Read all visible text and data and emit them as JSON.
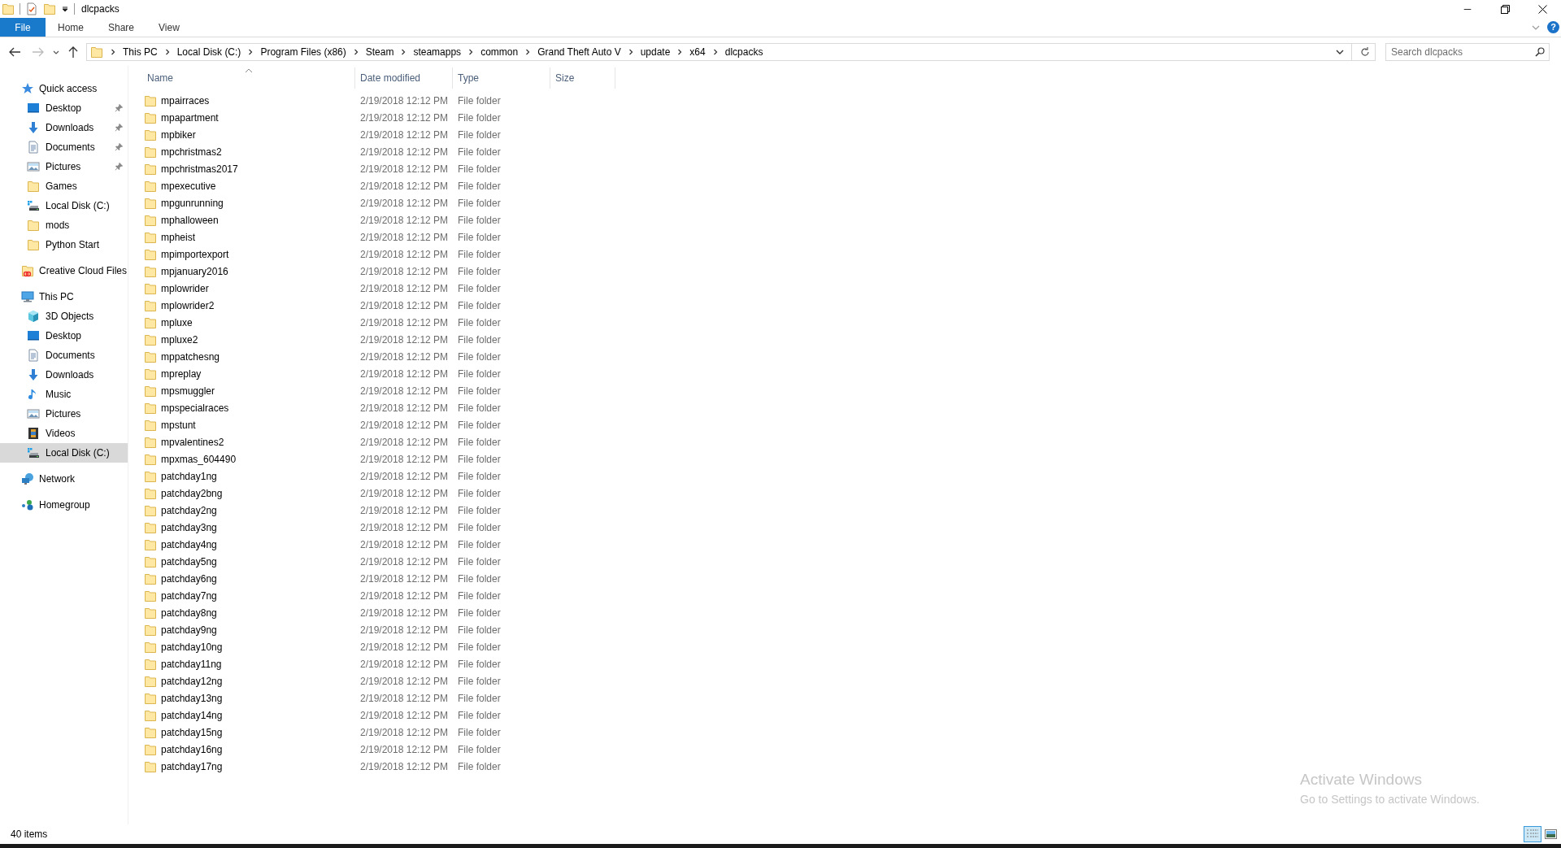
{
  "window": {
    "title": "dlcpacks",
    "minimize": "─",
    "help": "?"
  },
  "ribbon_tabs": [
    {
      "label": "File",
      "selected": true
    },
    {
      "label": "Home",
      "selected": false
    },
    {
      "label": "Share",
      "selected": false
    },
    {
      "label": "View",
      "selected": false
    }
  ],
  "breadcrumbs": [
    "This PC",
    "Local Disk (C:)",
    "Program Files (x86)",
    "Steam",
    "steamapps",
    "common",
    "Grand Theft Auto V",
    "update",
    "x64",
    "dlcpacks"
  ],
  "search": {
    "placeholder": "Search dlcpacks"
  },
  "sidebar": [
    {
      "label": "Quick access",
      "kind": "star",
      "children": [
        {
          "label": "Desktop",
          "kind": "desktop",
          "pinned": true,
          "selected": false
        },
        {
          "label": "Downloads",
          "kind": "download",
          "pinned": true,
          "selected": false
        },
        {
          "label": "Documents",
          "kind": "document",
          "pinned": true,
          "selected": false
        },
        {
          "label": "Pictures",
          "kind": "picture",
          "pinned": true,
          "selected": false
        },
        {
          "label": "Games",
          "kind": "folder",
          "pinned": false,
          "selected": false
        },
        {
          "label": "Local Disk (C:)",
          "kind": "drive",
          "pinned": false,
          "selected": false
        },
        {
          "label": "mods",
          "kind": "folder",
          "pinned": false,
          "selected": false
        },
        {
          "label": "Python Start",
          "kind": "folder",
          "pinned": false,
          "selected": false
        }
      ]
    },
    {
      "label": "Creative Cloud Files",
      "kind": "cloud"
    },
    {
      "label": "This PC",
      "kind": "pc",
      "children": [
        {
          "label": "3D Objects",
          "kind": "cube",
          "pinned": false,
          "selected": false
        },
        {
          "label": "Desktop",
          "kind": "desktop",
          "pinned": false,
          "selected": false
        },
        {
          "label": "Documents",
          "kind": "document",
          "pinned": false,
          "selected": false
        },
        {
          "label": "Downloads",
          "kind": "download",
          "pinned": false,
          "selected": false
        },
        {
          "label": "Music",
          "kind": "music",
          "pinned": false,
          "selected": false
        },
        {
          "label": "Pictures",
          "kind": "picture",
          "pinned": false,
          "selected": false
        },
        {
          "label": "Videos",
          "kind": "video",
          "pinned": false,
          "selected": false
        },
        {
          "label": "Local Disk (C:)",
          "kind": "drive",
          "pinned": false,
          "selected": true
        }
      ]
    },
    {
      "label": "Network",
      "kind": "network"
    },
    {
      "label": "Homegroup",
      "kind": "homegroup"
    }
  ],
  "table": {
    "columns": [
      {
        "label": "Name",
        "sorted": true
      },
      {
        "label": "Date modified",
        "sorted": false
      },
      {
        "label": "Type",
        "sorted": false
      },
      {
        "label": "Size",
        "sorted": false
      }
    ],
    "rows": [
      {
        "name": "mpairraces",
        "date": "2/19/2018 12:12 PM",
        "type": "File folder"
      },
      {
        "name": "mpapartment",
        "date": "2/19/2018 12:12 PM",
        "type": "File folder"
      },
      {
        "name": "mpbiker",
        "date": "2/19/2018 12:12 PM",
        "type": "File folder"
      },
      {
        "name": "mpchristmas2",
        "date": "2/19/2018 12:12 PM",
        "type": "File folder"
      },
      {
        "name": "mpchristmas2017",
        "date": "2/19/2018 12:12 PM",
        "type": "File folder"
      },
      {
        "name": "mpexecutive",
        "date": "2/19/2018 12:12 PM",
        "type": "File folder"
      },
      {
        "name": "mpgunrunning",
        "date": "2/19/2018 12:12 PM",
        "type": "File folder"
      },
      {
        "name": "mphalloween",
        "date": "2/19/2018 12:12 PM",
        "type": "File folder"
      },
      {
        "name": "mpheist",
        "date": "2/19/2018 12:12 PM",
        "type": "File folder"
      },
      {
        "name": "mpimportexport",
        "date": "2/19/2018 12:12 PM",
        "type": "File folder"
      },
      {
        "name": "mpjanuary2016",
        "date": "2/19/2018 12:12 PM",
        "type": "File folder"
      },
      {
        "name": "mplowrider",
        "date": "2/19/2018 12:12 PM",
        "type": "File folder"
      },
      {
        "name": "mplowrider2",
        "date": "2/19/2018 12:12 PM",
        "type": "File folder"
      },
      {
        "name": "mpluxe",
        "date": "2/19/2018 12:12 PM",
        "type": "File folder"
      },
      {
        "name": "mpluxe2",
        "date": "2/19/2018 12:12 PM",
        "type": "File folder"
      },
      {
        "name": "mppatchesng",
        "date": "2/19/2018 12:12 PM",
        "type": "File folder"
      },
      {
        "name": "mpreplay",
        "date": "2/19/2018 12:12 PM",
        "type": "File folder"
      },
      {
        "name": "mpsmuggler",
        "date": "2/19/2018 12:12 PM",
        "type": "File folder"
      },
      {
        "name": "mpspecialraces",
        "date": "2/19/2018 12:12 PM",
        "type": "File folder"
      },
      {
        "name": "mpstunt",
        "date": "2/19/2018 12:12 PM",
        "type": "File folder"
      },
      {
        "name": "mpvalentines2",
        "date": "2/19/2018 12:12 PM",
        "type": "File folder"
      },
      {
        "name": "mpxmas_604490",
        "date": "2/19/2018 12:12 PM",
        "type": "File folder"
      },
      {
        "name": "patchday1ng",
        "date": "2/19/2018 12:12 PM",
        "type": "File folder"
      },
      {
        "name": "patchday2bng",
        "date": "2/19/2018 12:12 PM",
        "type": "File folder"
      },
      {
        "name": "patchday2ng",
        "date": "2/19/2018 12:12 PM",
        "type": "File folder"
      },
      {
        "name": "patchday3ng",
        "date": "2/19/2018 12:12 PM",
        "type": "File folder"
      },
      {
        "name": "patchday4ng",
        "date": "2/19/2018 12:12 PM",
        "type": "File folder"
      },
      {
        "name": "patchday5ng",
        "date": "2/19/2018 12:12 PM",
        "type": "File folder"
      },
      {
        "name": "patchday6ng",
        "date": "2/19/2018 12:12 PM",
        "type": "File folder"
      },
      {
        "name": "patchday7ng",
        "date": "2/19/2018 12:12 PM",
        "type": "File folder"
      },
      {
        "name": "patchday8ng",
        "date": "2/19/2018 12:12 PM",
        "type": "File folder"
      },
      {
        "name": "patchday9ng",
        "date": "2/19/2018 12:12 PM",
        "type": "File folder"
      },
      {
        "name": "patchday10ng",
        "date": "2/19/2018 12:12 PM",
        "type": "File folder"
      },
      {
        "name": "patchday11ng",
        "date": "2/19/2018 12:12 PM",
        "type": "File folder"
      },
      {
        "name": "patchday12ng",
        "date": "2/19/2018 12:12 PM",
        "type": "File folder"
      },
      {
        "name": "patchday13ng",
        "date": "2/19/2018 12:12 PM",
        "type": "File folder"
      },
      {
        "name": "patchday14ng",
        "date": "2/19/2018 12:12 PM",
        "type": "File folder"
      },
      {
        "name": "patchday15ng",
        "date": "2/19/2018 12:12 PM",
        "type": "File folder"
      },
      {
        "name": "patchday16ng",
        "date": "2/19/2018 12:12 PM",
        "type": "File folder"
      },
      {
        "name": "patchday17ng",
        "date": "2/19/2018 12:12 PM",
        "type": "File folder"
      }
    ]
  },
  "status_bar": {
    "count": "40 items",
    "views": [
      {
        "kind": "details",
        "selected": true
      },
      {
        "kind": "large",
        "selected": false
      }
    ]
  },
  "activation_notice": {
    "title": "Activate Windows",
    "text": "Go to Settings to activate Windows."
  }
}
